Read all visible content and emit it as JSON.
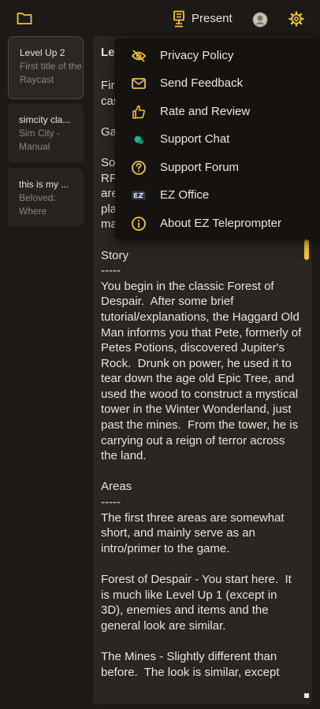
{
  "topbar": {
    "present_label": "Present"
  },
  "sidebar": {
    "notes": [
      {
        "title": "Level Up 2",
        "subtitle": "First title of the Raycast"
      },
      {
        "title": "simcity cla...",
        "subtitle": "Sim City - Manual"
      },
      {
        "title": "this is my ...",
        "subtitle": "Beloved: Where"
      }
    ]
  },
  "editor": {
    "title": "Le",
    "body": "Fir\ncas\n\nGa\n\nSo\nRP\nare\npla\nma\n\nStory\n-----\nYou begin in the classic Forest of Despair.  After some brief tutorial/explanations, the Haggard Old Man informs you that Pete, formerly of Petes Potions, discovered Jupiter's Rock.  Drunk on power, he used it to tear down the age old Epic Tree, and used the wood to construct a mystical tower in the Winter Wonderland, just past the mines.  From the tower, he is carrying out a reign of terror across the land.\n\nAreas\n-----\nThe first three areas are somewhat short, and mainly serve as an intro/primer to the game.\n\nForest of Despair - You start here.  It is much like Level Up 1 (except in 3D), enemies and items and the general look are similar.\n\nThe Mines - Slightly different than before.  The look is similar, except"
  },
  "menu": {
    "items": [
      {
        "label": "Privacy Policy",
        "icon": "eye-off-icon"
      },
      {
        "label": "Send Feedback",
        "icon": "mail-icon"
      },
      {
        "label": "Rate and Review",
        "icon": "thumbs-up-icon"
      },
      {
        "label": "Support Chat",
        "icon": "chat-icon"
      },
      {
        "label": "Support Forum",
        "icon": "help-circle-icon"
      },
      {
        "label": "EZ Office",
        "icon": "ez-office-icon"
      },
      {
        "label": "About EZ Teleprompter",
        "icon": "info-icon"
      }
    ]
  },
  "colors": {
    "accent": "#f1c232",
    "background": "#1b1a17",
    "panel": "#292622",
    "menu": "#141311"
  }
}
